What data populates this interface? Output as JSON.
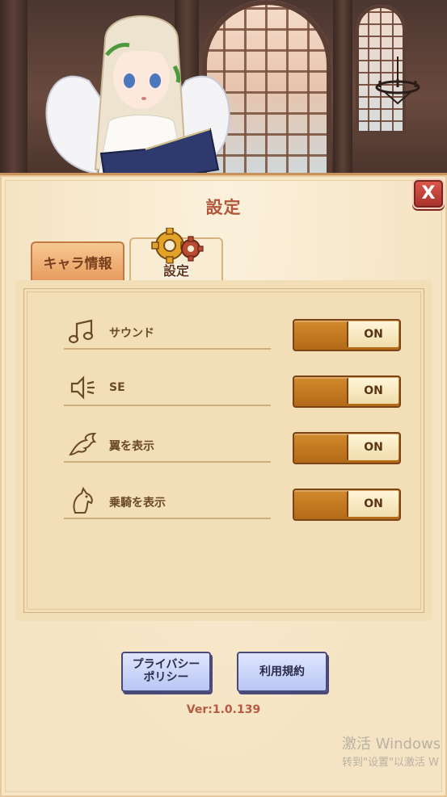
{
  "dialog": {
    "title": "設定",
    "close_label": "X"
  },
  "tabs": [
    {
      "label": "キャラ情報",
      "active": false
    },
    {
      "label": "設定",
      "active": true
    }
  ],
  "settings": [
    {
      "icon": "music-note-icon",
      "label": "サウンド",
      "state": "ON"
    },
    {
      "icon": "speaker-icon",
      "label": "SE",
      "state": "ON"
    },
    {
      "icon": "wing-icon",
      "label": "翼を表示",
      "state": "ON"
    },
    {
      "icon": "mount-icon",
      "label": "乗騎を表示",
      "state": "ON"
    }
  ],
  "buttons": {
    "privacy": "プライバシー\nポリシー",
    "terms": "利用規約"
  },
  "version": "Ver:1.0.139",
  "watermark": {
    "line1": "激活 Windows",
    "line2": "转到\"设置\"以激活 W"
  },
  "colors": {
    "accent": "#b2573a",
    "toggle_on": "#c27a22",
    "panel": "#f7e7c7"
  }
}
